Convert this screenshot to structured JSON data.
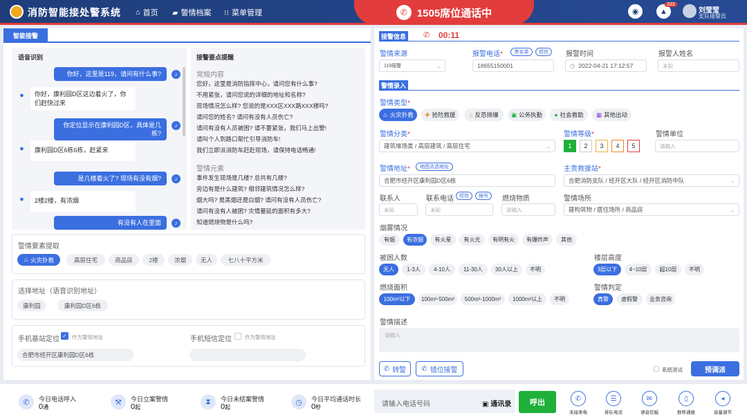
{
  "header": {
    "app_title": "消防智能接处警系统",
    "nav": [
      {
        "icon": "home-icon",
        "glyph": "⌂",
        "label": "首页"
      },
      {
        "icon": "folder-icon",
        "glyph": "▰",
        "label": "警情档案"
      },
      {
        "icon": "grid-icon",
        "glyph": "⁝⁝",
        "label": "菜单管理"
      }
    ],
    "call_status": "1505席位通话中",
    "notification_count": "333",
    "user_name": "刘莹莹",
    "user_role": "支队接警员"
  },
  "left": {
    "tab": "智能接警",
    "voice_title": "语音识别",
    "hints_title": "接警要点提醒",
    "messages": [
      {
        "dir": "out",
        "text": "你好，这里是119，请问有什么事?"
      },
      {
        "dir": "in",
        "text": "你好，康利园D区这边着火了，你们赶快过来"
      },
      {
        "dir": "out",
        "text": "你定位显示在康利园D区，具体是几栋?"
      },
      {
        "dir": "in",
        "text": "康利园D区6栋6栋，赶紧来"
      },
      {
        "dir": "out",
        "text": "是几楼着火了? 现场有没有烟?"
      },
      {
        "dir": "in",
        "text": "2楼2楼，有浓烟"
      },
      {
        "dir": "out",
        "text": "有没有人在里面"
      }
    ],
    "hints": {
      "regular_title": "常规内容",
      "regular": [
        "您好，这里是消防指挥中心，请问您有什么事?",
        "不用紧张，请问您说的详细的地址和名称?",
        "现场情况怎么样?   您说的是XXX区XXX路XXX楼吗?",
        "请问您的姓名?  请问有没有人员伤亡?",
        "请问有没有人员被困?   请不要紧张，我们马上出警!",
        "请叫个人到路口帮忙引导消防车!",
        "我们立即派消防车赶赴现场，请保持电话畅通!"
      ],
      "elements_title": "警情元素",
      "elements": [
        "事件发生现场是几楼? 总共有几楼?",
        "旁边有是什么建筑?  相邻建筑情况怎么样?",
        "烟大吗? 是黑烟还是白烟?   请问有没有人员伤亡?",
        "请问有没有人被困?    灾情蔓延的面积有多大?",
        "知道燃烧物是什么吗?"
      ]
    },
    "extract": {
      "title": "警情要素提取",
      "chips": [
        "火灾扑救",
        "高层住宅",
        "商品房",
        "2楼",
        "浓烟",
        "无人",
        "七八十平方米"
      ]
    },
    "address": {
      "title": "选择地址（语音识别地址）",
      "chips": [
        "康利园",
        "康利园D区6栋"
      ]
    },
    "location": {
      "base_title": "手机基站定位",
      "base_check": "作为警情地址",
      "base_value": "合肥市经开区康利园D区6栋",
      "sms_title": "手机短信定位",
      "sms_check": "作为警情地址",
      "sms_value": ""
    }
  },
  "right": {
    "info_title": "接警信息",
    "timer": "00:11",
    "source_label": "警情来源",
    "source_value": "119报警",
    "phone_label": "报警电话",
    "phone_tags": [
      "黑名单",
      "短信"
    ],
    "phone_value": "18655150001",
    "time_label": "报警时间",
    "time_value": "2022-04-21 17:12:57",
    "name_label": "报警人姓名",
    "name_value": "未知",
    "entry_title": "警情录入",
    "type_label": "警情类型",
    "types": [
      {
        "icon": "fire-icon",
        "glyph": "🔥",
        "label": "火灾扑救"
      },
      {
        "icon": "rescue-icon",
        "glyph": "✚",
        "label": "抢险救援"
      },
      {
        "icon": "anti-terror-icon",
        "glyph": "⌂",
        "label": "反恐排爆"
      },
      {
        "icon": "briefcase-icon",
        "glyph": "▣",
        "label": "公务执勤"
      },
      {
        "icon": "social-icon",
        "glyph": "●",
        "label": "社会救助"
      },
      {
        "icon": "other-icon",
        "glyph": "▦",
        "label": "其他出动"
      }
    ],
    "subtype_label": "警情分类",
    "subtype_value": "建筑堆场类 / 高层建筑 / 高层住宅",
    "level_label": "警情等级",
    "levels": [
      "1",
      "2",
      "3",
      "4",
      "5"
    ],
    "unit_label": "警情单位",
    "unit_ph": "请输入",
    "address_label": "警情地址",
    "address_tag": "地图点选地址",
    "address_value": "合肥市经开区康利园D区6栋",
    "station_label": "主责救援站",
    "station_value": "合肥消防支队 / 经开区大队 / 经开区消防中队",
    "contact_label": "联系人",
    "contact_value": "未知",
    "contact_phone_label": "联系电话",
    "contact_phone_tags": [
      "短信",
      "拨号"
    ],
    "contact_phone_value": "未知",
    "burn_label": "燃烧物质",
    "burn_ph": "请输入",
    "place_label": "警情场所",
    "place_value": "建构筑物 / 居住场所 / 商品房",
    "smoke_label": "烟雾情况",
    "smoke": [
      "有烟",
      "有浓烟",
      "有火星",
      "有火光",
      "有明有火",
      "有爆炸声",
      "其他"
    ],
    "trapped_label": "被困人数",
    "trapped": [
      "无人",
      "1-3人",
      "4-10人",
      "11-30人",
      "30人以上",
      "不明"
    ],
    "floor_label": "楼层高度",
    "floors": [
      "3层以下",
      "4~10层",
      "超10层",
      "不明"
    ],
    "area_label": "燃烧面积",
    "areas": [
      "100m²以下",
      "100m²-500m²",
      "500m²-1000m²",
      "1000m²以上",
      "不明"
    ],
    "judge_label": "警情判定",
    "judges": [
      "真警",
      "虚假警",
      "业务咨询"
    ],
    "desc_label": "警情描述",
    "desc_ph": "请输入",
    "transfer_btn": "转警",
    "misdial_btn": "错位接警",
    "test_check": "系统测试",
    "dispatch_btn": "预调派"
  },
  "bottom": {
    "stats": [
      {
        "icon": "phone-in-icon",
        "glyph": "✆",
        "label": "今日电话呼入",
        "value": "0",
        "unit": "通"
      },
      {
        "icon": "gavel-icon",
        "glyph": "⚒",
        "label": "今日立案警情",
        "value": "0",
        "unit": "起"
      },
      {
        "icon": "hourglass-icon",
        "glyph": "⧗",
        "label": "今日未结案警情",
        "value": "0",
        "unit": "起"
      },
      {
        "icon": "stopwatch-icon",
        "glyph": "◷",
        "label": "今日平均通话时长",
        "value": "0",
        "unit": "秒"
      }
    ],
    "dial_placeholder": "请输入电话号码",
    "address_book": "通讯录",
    "call_btn": "呼出",
    "tools": [
      {
        "icon": "missed-call-icon",
        "glyph": "✆",
        "label": "未接来电"
      },
      {
        "icon": "queue-call-icon",
        "glyph": "☰",
        "label": "排队电话"
      },
      {
        "icon": "voicemail-icon",
        "glyph": "✉",
        "label": "语音信箱"
      },
      {
        "icon": "group-call-icon",
        "glyph": "▯",
        "label": "群呼通报"
      },
      {
        "icon": "volume-icon",
        "glyph": "◂",
        "label": "音量调节"
      }
    ]
  }
}
